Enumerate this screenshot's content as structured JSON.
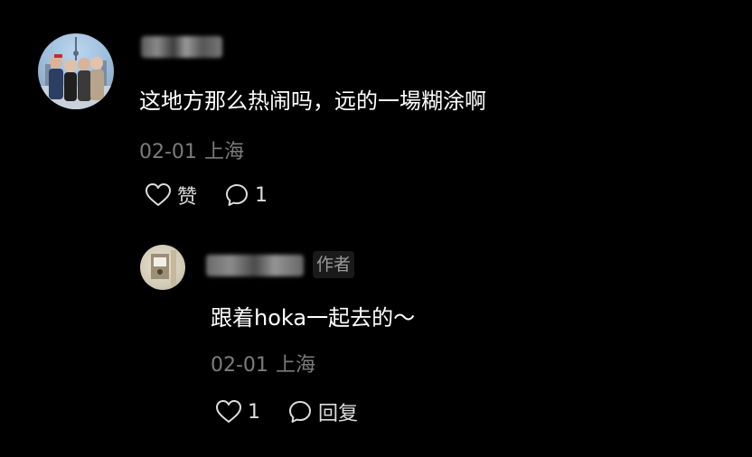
{
  "comment": {
    "text": "这地方那么热闹吗，远的一場糊涂啊",
    "date": "02-01",
    "location": "上海",
    "like_label": "赞",
    "reply_count": "1"
  },
  "reply": {
    "author_tag": "作者",
    "text": "跟着hoka一起去的～",
    "date": "02-01",
    "location": "上海",
    "like_count": "1",
    "reply_label": "回复"
  },
  "icons": {
    "like": "heart-outline-icon",
    "comment": "speech-bubble-icon"
  },
  "colors": {
    "background": "#000000",
    "text": "#ffffff",
    "meta": "#7c7c7c",
    "author_tag_bg": "#1a1a1a",
    "author_tag_text": "#9a9a9a"
  }
}
